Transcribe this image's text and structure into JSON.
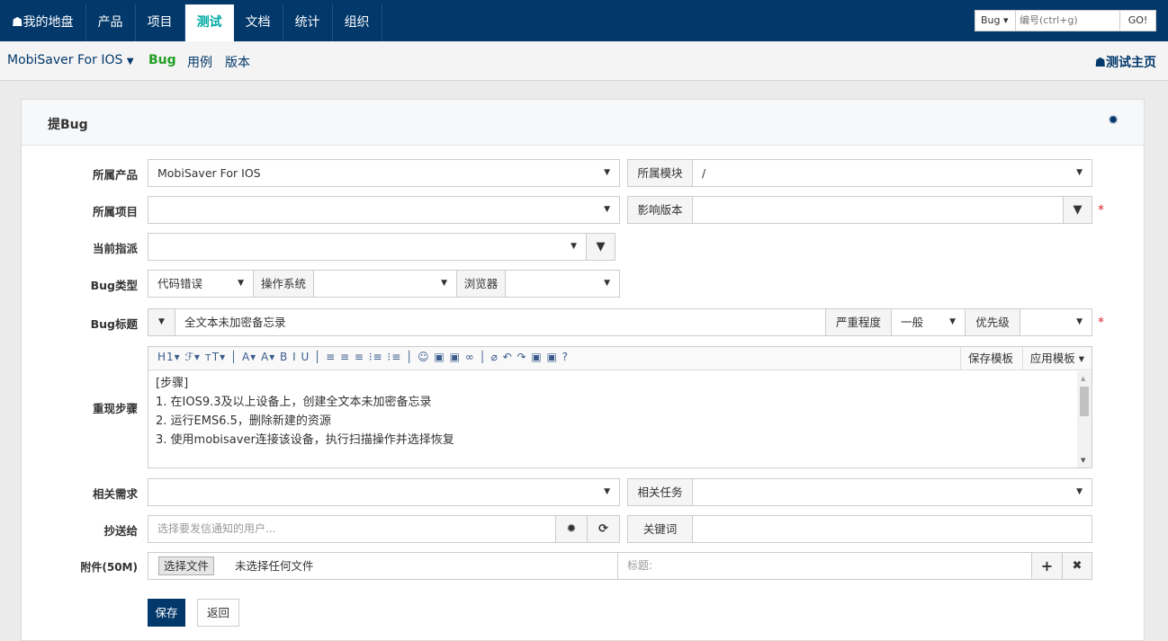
{
  "topnav": {
    "items": [
      {
        "label": "我的地盘",
        "icon": "home-icon"
      },
      {
        "label": "产品"
      },
      {
        "label": "项目"
      },
      {
        "label": "测试",
        "active": true
      },
      {
        "label": "文档"
      },
      {
        "label": "统计"
      },
      {
        "label": "组织"
      }
    ],
    "search": {
      "type": "Bug",
      "placeholder": "编号(ctrl+g)",
      "go": "GO!"
    }
  },
  "subnav": {
    "product": "MobiSaver For IOS",
    "items": [
      "Bug",
      "用例",
      "版本"
    ],
    "active": "Bug",
    "home": "测试主页"
  },
  "panel": {
    "title": "提Bug",
    "settings_icon": "gear-icon"
  },
  "form": {
    "product": {
      "label": "所属产品",
      "value": "MobiSaver For IOS"
    },
    "module": {
      "label": "所属模块",
      "value": "/"
    },
    "project": {
      "label": "所属项目",
      "value": ""
    },
    "builds": {
      "label": "影响版本",
      "value": ""
    },
    "assigned": {
      "label": "当前指派",
      "value": ""
    },
    "type": {
      "label": "Bug类型",
      "value": "代码错误",
      "os_label": "操作系统",
      "os_value": "",
      "browser_label": "浏览器",
      "browser_value": ""
    },
    "title": {
      "label": "Bug标题",
      "value": "全文本未加密备忘录",
      "severity_label": "严重程度",
      "severity_value": "一般",
      "priority_label": "优先级",
      "priority_value": ""
    },
    "steps": {
      "label": "重现步骤",
      "save_template": "保存模板",
      "apply_template": "应用模板",
      "toolbar": "H1▾ ℱ▾ ᴛT▾ │ A▾ A▾ B I U │ ≡ ≡ ≡ ⁝≡ ⁝≡ │ ☺ ▣ ▣ ∞ │ ⌀ ↶ ↷ ▣ ▣ ?",
      "lines": [
        "[步骤]",
        "1. 在IOS9.3及以上设备上，创建全文本未加密备忘录",
        "2. 运行EMS6.5，删除新建的资源",
        "3. 使用mobisaver连接该设备，执行扫描操作并选择恢复"
      ]
    },
    "story": {
      "label": "相关需求",
      "value": ""
    },
    "task": {
      "label": "相关任务",
      "value": ""
    },
    "mailto": {
      "label": "抄送给",
      "placeholder": "选择要发信通知的用户..."
    },
    "keywords": {
      "label": "关键词",
      "value": ""
    },
    "files": {
      "label": "附件(50M)",
      "choose": "选择文件",
      "none": "未选择任何文件",
      "title_placeholder": "标题:"
    }
  },
  "buttons": {
    "save": "保存",
    "back": "返回"
  },
  "colors": {
    "nav_bg": "#03386b",
    "active_tab": "#00a9a4",
    "bug_green": "#229f24",
    "required": "#d9232e"
  }
}
